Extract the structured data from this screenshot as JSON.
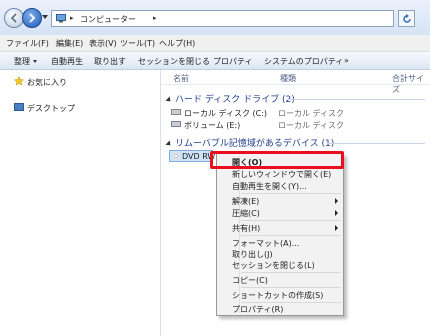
{
  "addressbar": {
    "crumb_sep": "▸",
    "location": "コンピューター",
    "trail_sep": "▸"
  },
  "menubar": {
    "items": [
      "ファイル(F)",
      "編集(E)",
      "表示(V)",
      "ツール(T)",
      "ヘルプ(H)"
    ]
  },
  "toolbar": {
    "items": [
      "整理",
      "自動再生",
      "取り出す",
      "セッションを閉じる",
      "プロパティ",
      "システムのプロパティ",
      "»"
    ]
  },
  "navpane": {
    "favorites": "お気に入り",
    "desktop": "デスクトップ"
  },
  "columns": {
    "name": "名前",
    "type": "種類",
    "total": "合計サイズ"
  },
  "groups": {
    "hdd": {
      "title": "ハード ディスク ドライブ (2)",
      "items": [
        {
          "name": "ローカル ディスク (C:)",
          "type": "ローカル ディスク"
        },
        {
          "name": "ボリューム (E:)",
          "type": "ローカル ディスク"
        }
      ]
    },
    "removable": {
      "title": "リムーバブル記憶域があるデバイス (1)",
      "dvd": "DVD RW"
    }
  },
  "context_menu": {
    "open": "開く(O)",
    "open_new_window": "新しいウィンドウで開く(E)",
    "autoplay": "自動再生を開く(Y)...",
    "unzip": "解凍(E)",
    "compress": "圧縮(C)",
    "share": "共有(H)",
    "format": "フォーマット(A)...",
    "eject": "取り出し(J)",
    "close_session": "セッションを閉じる(L)",
    "copy": "コピー(C)",
    "create_shortcut": "ショートカットの作成(S)",
    "properties": "プロパティ(R)"
  },
  "colors": {
    "highlight": "#e8101f",
    "group_header": "#1e3e8c"
  }
}
